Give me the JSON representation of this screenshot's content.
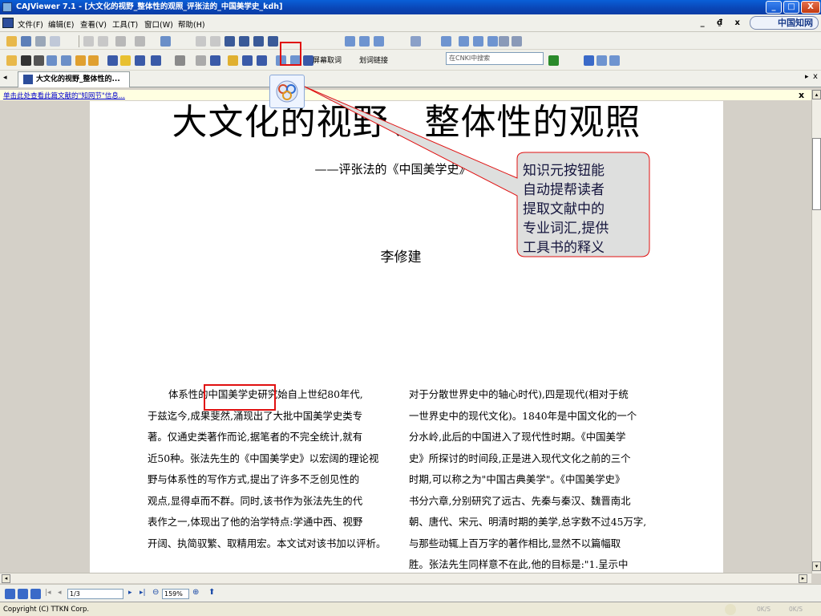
{
  "window": {
    "title": "CAJViewer 7.1 - [大文化的视野_整体性的观照_评张法的_中国美学史_kdh]",
    "min": "_",
    "max": "□",
    "close": "X"
  },
  "menubar": {
    "items": [
      "文件(F)",
      "编辑(E)",
      "查看(V)",
      "工具(T)",
      "窗口(W)",
      "帮助(H)"
    ],
    "mdi_controls": "_ ₫ x",
    "logo": "中国知网"
  },
  "toolbar3": {
    "screen_word": "屏幕取词",
    "word_link": "划词链接",
    "search_placeholder": "在CNKI中搜索"
  },
  "tab": {
    "label": "大文化的视野_整体性的..."
  },
  "infobar": {
    "text": "单击此处查看此篇文献的\"知网节\"信息..."
  },
  "document": {
    "title": "大文化的视野、整体性的观照",
    "subtitle": "——评张法的《中国美学史》",
    "author": "李修建",
    "left_lines": [
      "体系性的中国美学史研究始自上世纪80年代,",
      "于兹迄今,成果斐然,涌现出了大批中国美学史类专",
      "著。仅通史类著作而论,据笔者的不完全统计,就有",
      "近50种。张法先生的《中国美学史》以宏阔的理论视",
      "野与体系性的写作方式,提出了许多不乏创见性的",
      "观点,显得卓而不群。同时,该书作为张法先生的代",
      "表作之一,体现出了他的治学特点:学通中西、视野",
      "开阔、执简驭繁、取精用宏。本文试对该书加以评析。"
    ],
    "right_lines": [
      "对于分散世界史中的轴心时代),四是现代(相对于统",
      "一世界史中的现代文化)。1840年是中国文化的一个",
      "分水岭,此后的中国进入了现代性时期。《中国美学",
      "史》所探讨的时间段,正是进入现代文化之前的三个",
      "时期,可以称之为\"中国古典美学\"。《中国美学史》",
      "书分六章,分别研究了远古、先秦与秦汉、魏晋南北",
      "朝、唐代、宋元、明清时期的美学,总字数不过45万字,",
      "与那些动辄上百万字的著作相比,显然不以篇幅取",
      "胜。张法先生同样意不在此,他的目标是:\"1.呈示中"
    ]
  },
  "callout": {
    "lines": [
      "知识元按钮能",
      "自动提帮读者",
      "提取文献中的",
      "专业词汇,提供",
      "工具书的释义"
    ]
  },
  "navbar": {
    "page": "1/3",
    "zoom": "159%"
  },
  "statusbar": {
    "copyright": "Copyright (C) TTKN Corp.",
    "speed_down": "0K/S",
    "speed_up": "0K/S"
  },
  "colors": {
    "title_bar": "#0a45b5",
    "highlight_red": "#e01010",
    "callout_fill": "#dedfde"
  }
}
